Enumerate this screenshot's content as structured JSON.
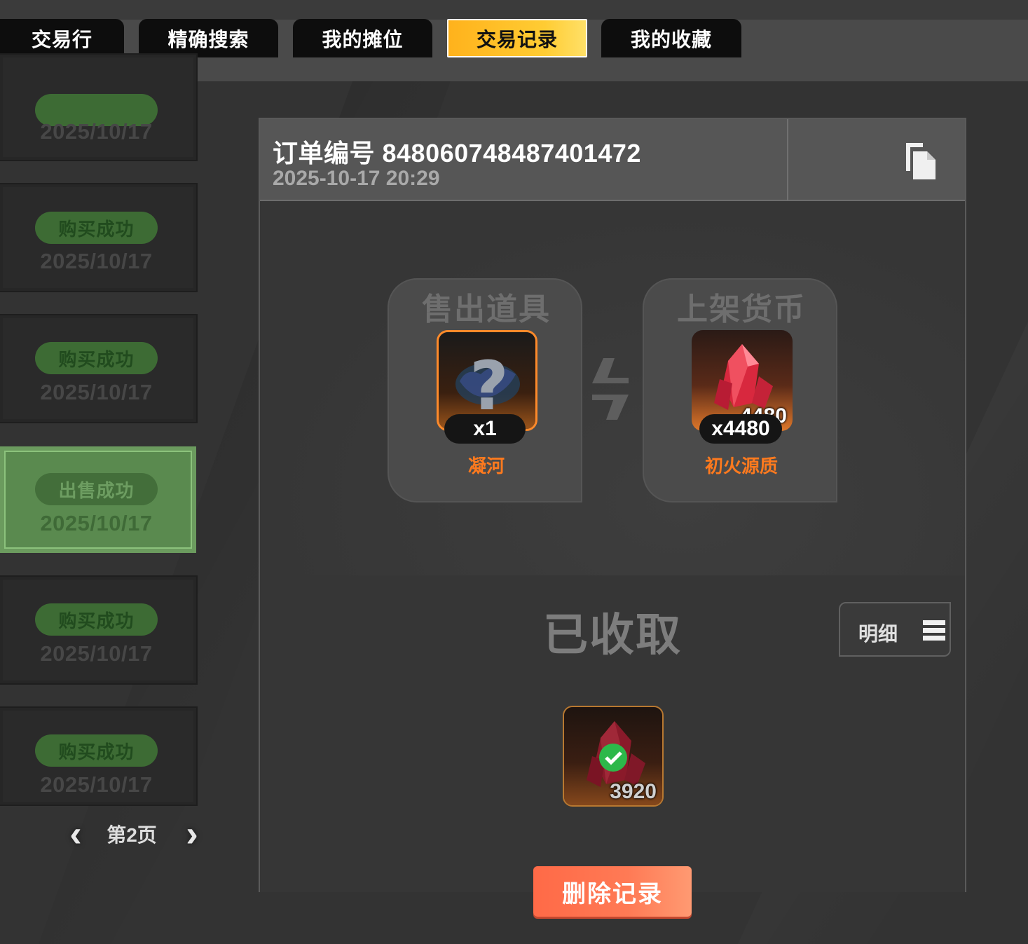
{
  "tabs": [
    {
      "label": "交易行"
    },
    {
      "label": "精确搜索"
    },
    {
      "label": "我的摊位"
    },
    {
      "label": "交易记录",
      "active": true
    },
    {
      "label": "我的收藏"
    }
  ],
  "records": [
    {
      "status": "",
      "date": "2025/10/17"
    },
    {
      "status": "购买成功",
      "date": "2025/10/17"
    },
    {
      "status": "购买成功",
      "date": "2025/10/17"
    },
    {
      "status": "出售成功",
      "date": "2025/10/17",
      "selected": true
    },
    {
      "status": "购买成功",
      "date": "2025/10/17"
    },
    {
      "status": "购买成功",
      "date": "2025/10/17"
    }
  ],
  "pager": {
    "label": "第2页",
    "prev_icon": "chevron-left-icon",
    "next_icon": "chevron-right-icon"
  },
  "order": {
    "number_text": "订单编号 848060748487401472",
    "time": "2025-10-17 20:29",
    "copy_icon": "copy-icon"
  },
  "sell": {
    "title": "售出道具",
    "item_name": "凝河",
    "quantity": "x1"
  },
  "listing": {
    "title": "上架货币",
    "item_name": "初火源质",
    "icon_count": "4480",
    "quantity": "x4480"
  },
  "collected": {
    "title": "已收取",
    "detail_label": "明细",
    "reward_count": "3920"
  },
  "delete_label": "删除记录",
  "colors": {
    "accent": "#ffc02a",
    "success_green": "#3d6b34",
    "item_orange": "#ff7a1e",
    "delete_red": "#ff6a47"
  }
}
